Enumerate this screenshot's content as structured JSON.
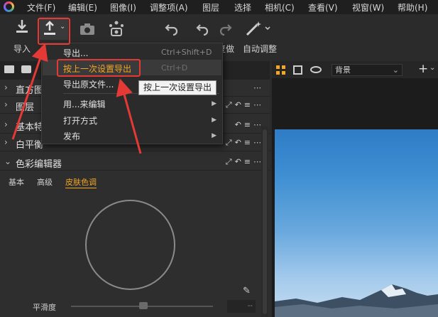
{
  "menubar": {
    "items": [
      "文件(F)",
      "编辑(E)",
      "图像(I)",
      "调整项(A)",
      "图层",
      "选择",
      "相机(C)",
      "查看(V)",
      "视窗(W)",
      "帮助(H)"
    ]
  },
  "toolbar": {
    "import_label": "导入",
    "redo_label_partial": "复做",
    "auto_adjust_label": "自动调整"
  },
  "left_panel": {
    "sections": [
      {
        "title": "直方图",
        "expanded": false
      },
      {
        "title": "图层",
        "expanded": false
      },
      {
        "title": "基本特性",
        "expanded": false
      },
      {
        "title": "白平衡",
        "expanded": false
      },
      {
        "title": "色彩编辑器",
        "expanded": true
      }
    ],
    "color_editor_tabs": [
      "基本",
      "高级",
      "皮肤色调"
    ],
    "active_tab": "皮肤色调",
    "smoothness_label": "平滑度",
    "smoothness_value": "--"
  },
  "viewer": {
    "background_select": "背景"
  },
  "context_menu": {
    "items": [
      {
        "label": "导出...",
        "shortcut": "Ctrl+Shift+D",
        "submenu": false
      },
      {
        "label": "按上一次设置导出",
        "shortcut": "Ctrl+D",
        "submenu": false,
        "highlighted": true
      },
      {
        "label": "导出原文件...",
        "shortcut": "",
        "submenu": false
      },
      {
        "label": "用...来编辑",
        "shortcut": "",
        "submenu": true
      },
      {
        "label": "打开方式",
        "shortcut": "",
        "submenu": true
      },
      {
        "label": "发布",
        "shortcut": "",
        "submenu": true
      }
    ]
  },
  "tooltip": {
    "text": "按上一次设置导出"
  },
  "colors": {
    "accent_orange": "#f5a623",
    "annotation_red": "#e53935"
  }
}
